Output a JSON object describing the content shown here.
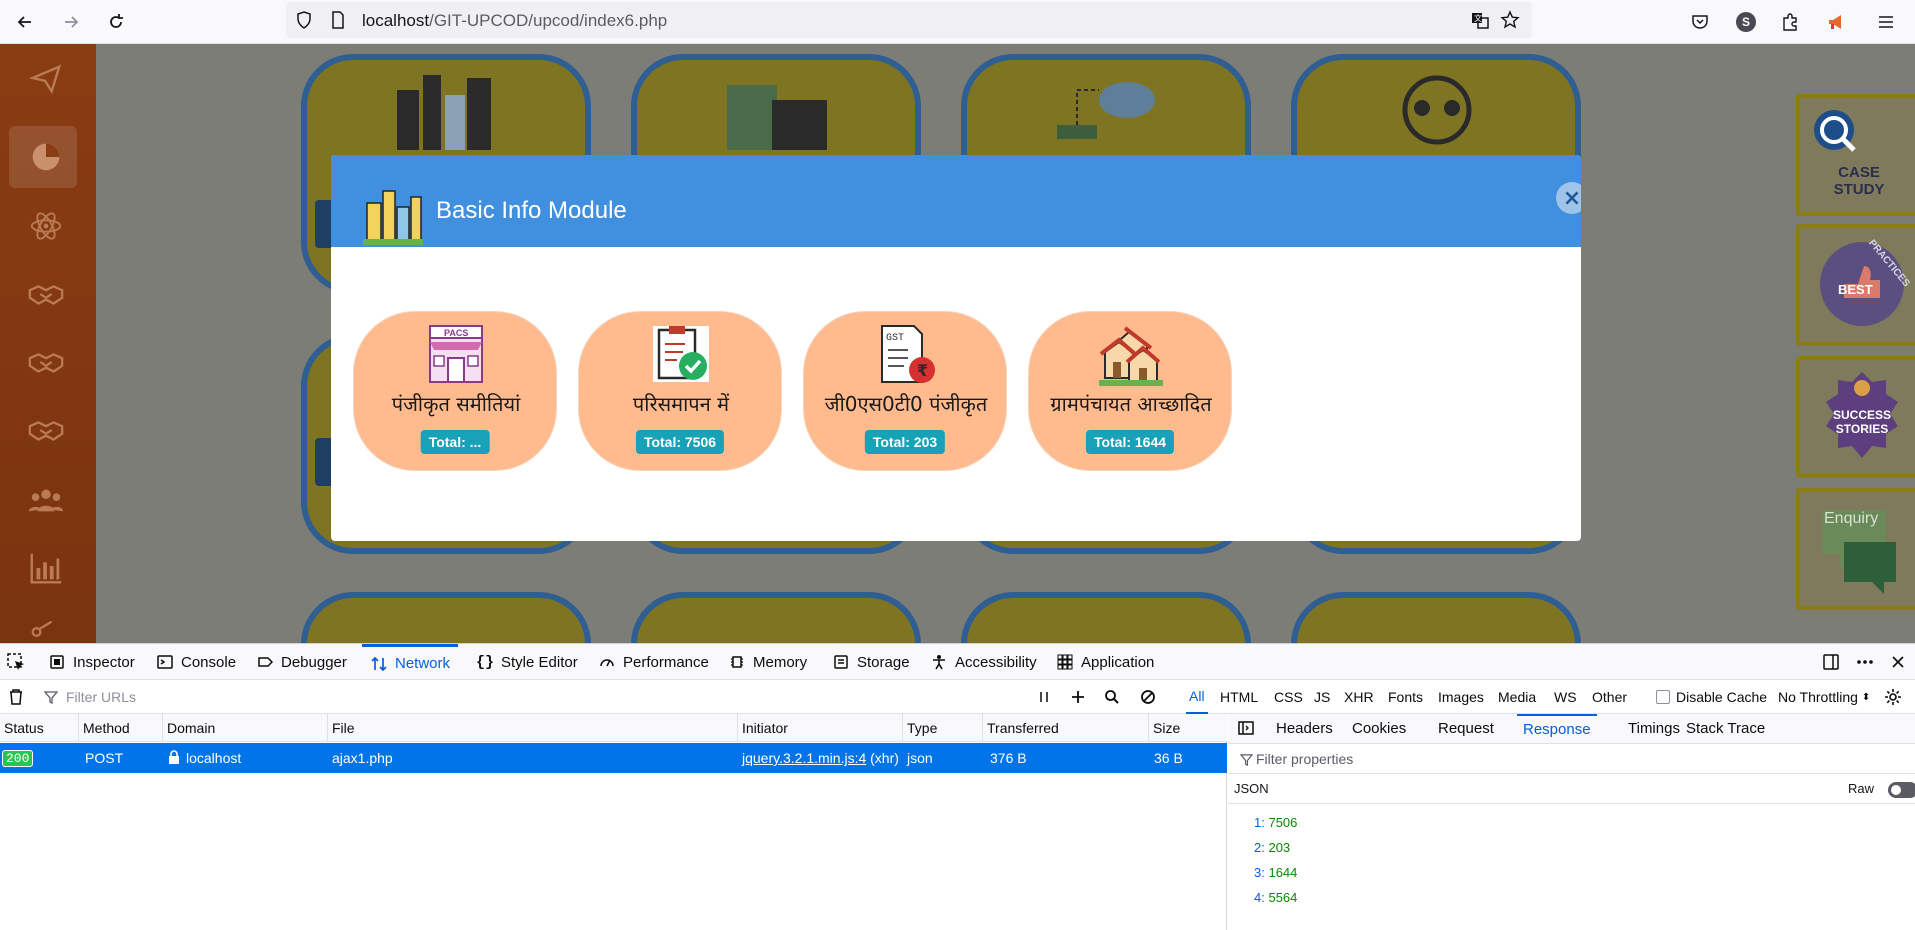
{
  "browser": {
    "url_host": "localhost",
    "url_path": "/GIT-UPCOD/upcod/index6.php",
    "avatar_letter": "S"
  },
  "right_cards": {
    "case_study": "CASE STUDY",
    "best_practices": "BEST",
    "practices": "PRACTICES",
    "success_stories": "SUCCESS STORIES",
    "enquiry": "Enquiry"
  },
  "modal": {
    "title": "Basic Info Module",
    "close_label": "×",
    "cards": [
      {
        "label": "पंजीकृत समीतियां",
        "total": "Total: ...",
        "icon": "pacs-shop-icon",
        "icon_text": "PACS"
      },
      {
        "label": "परिसमापन में",
        "total": "Total: 7506",
        "icon": "clipboard-check-icon"
      },
      {
        "label": "जी0एस0टी0 पंजीकृत",
        "total": "Total: 203",
        "icon": "gst-invoice-icon",
        "icon_text": "GST"
      },
      {
        "label": "ग्रामपंचायत आच्छादित",
        "total": "Total: 1644",
        "icon": "village-houses-icon"
      }
    ]
  },
  "devtools": {
    "tabs": [
      "Inspector",
      "Console",
      "Debugger",
      "Network",
      "Style Editor",
      "Performance",
      "Memory",
      "Storage",
      "Accessibility",
      "Application"
    ],
    "active_tab": "Network",
    "filter_placeholder": "Filter URLs",
    "type_filters": [
      "All",
      "HTML",
      "CSS",
      "JS",
      "XHR",
      "Fonts",
      "Images",
      "Media",
      "WS",
      "Other"
    ],
    "active_type_filter": "All",
    "disable_cache": "Disable Cache",
    "throttling": "No Throttling",
    "columns": [
      "Status",
      "Method",
      "Domain",
      "File",
      "Initiator",
      "Type",
      "Transferred",
      "Size"
    ],
    "request": {
      "status": "200",
      "method": "POST",
      "domain": "localhost",
      "file": "ajax1.php",
      "initiator_link": "jquery.3.2.1.min.js:4",
      "initiator_type": "(xhr)",
      "type": "json",
      "transferred": "376 B",
      "size": "36 B"
    },
    "detail_tabs": [
      "Headers",
      "Cookies",
      "Request",
      "Response",
      "Timings",
      "Stack Trace"
    ],
    "active_detail_tab": "Response",
    "filter_properties": "Filter properties",
    "json_label": "JSON",
    "raw_label": "Raw",
    "json_entries": [
      {
        "key": "1:",
        "value": "7506"
      },
      {
        "key": "2:",
        "value": "203"
      },
      {
        "key": "3:",
        "value": "1644"
      },
      {
        "key": "4:",
        "value": "5564"
      }
    ]
  }
}
